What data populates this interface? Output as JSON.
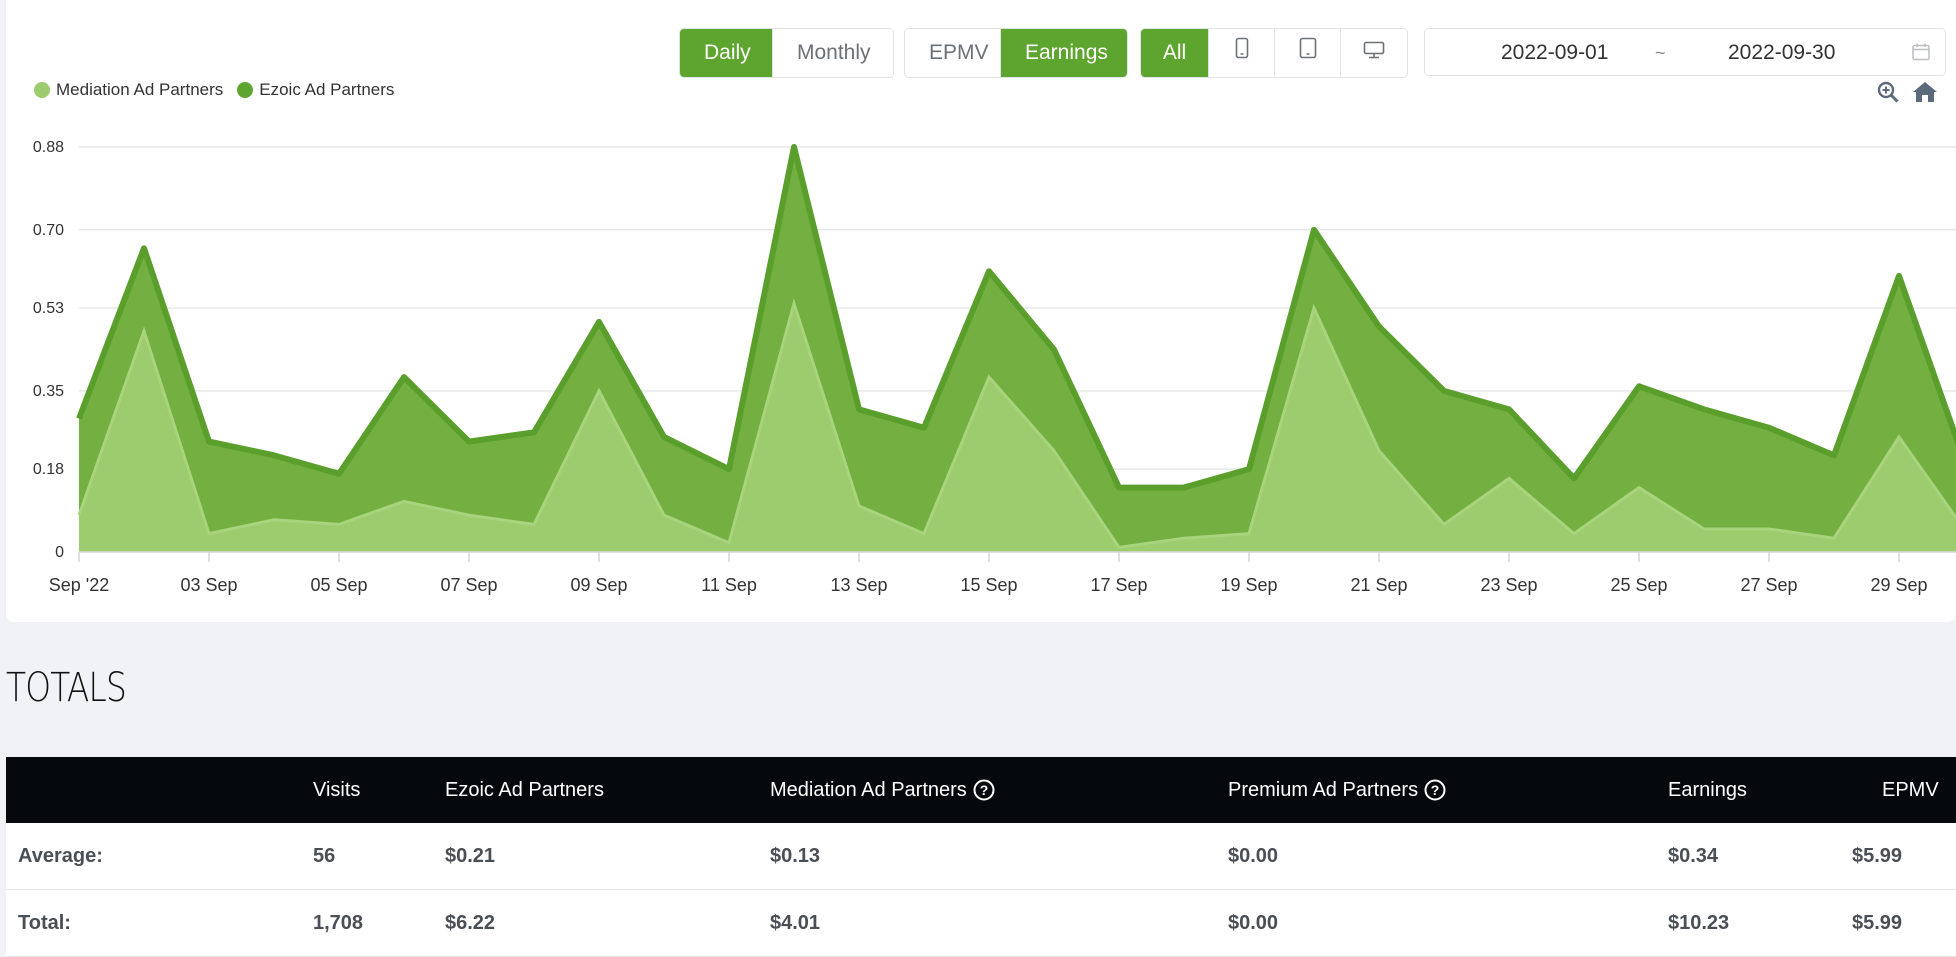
{
  "controls": {
    "period": [
      {
        "label": "Daily",
        "active": true
      },
      {
        "label": "Monthly",
        "active": false
      }
    ],
    "metric": [
      {
        "label": "EPMV",
        "active": false
      },
      {
        "label": "Earnings",
        "active": true
      }
    ],
    "device": [
      {
        "label": "All",
        "icon": "",
        "active": true
      },
      {
        "label": "",
        "icon": "mobile-icon",
        "active": false
      },
      {
        "label": "",
        "icon": "tablet-icon",
        "active": false
      },
      {
        "label": "",
        "icon": "desktop-icon",
        "active": false
      }
    ],
    "date_from": "2022-09-01",
    "date_sep": "~",
    "date_to": "2022-09-30"
  },
  "legend": [
    {
      "label": "Mediation Ad Partners",
      "color": "#9ccc6e"
    },
    {
      "label": "Ezoic Ad Partners",
      "color": "#5ea52f"
    }
  ],
  "chart_data": {
    "type": "area",
    "stacked": true,
    "x": [
      "2022-09-01",
      "2022-09-02",
      "2022-09-03",
      "2022-09-04",
      "2022-09-05",
      "2022-09-06",
      "2022-09-07",
      "2022-09-08",
      "2022-09-09",
      "2022-09-10",
      "2022-09-11",
      "2022-09-12",
      "2022-09-13",
      "2022-09-14",
      "2022-09-15",
      "2022-09-16",
      "2022-09-17",
      "2022-09-18",
      "2022-09-19",
      "2022-09-20",
      "2022-09-21",
      "2022-09-22",
      "2022-09-23",
      "2022-09-24",
      "2022-09-25",
      "2022-09-26",
      "2022-09-27",
      "2022-09-28",
      "2022-09-29",
      "2022-09-30"
    ],
    "x_tick_labels": [
      "Sep '22",
      "03 Sep",
      "05 Sep",
      "07 Sep",
      "09 Sep",
      "11 Sep",
      "13 Sep",
      "15 Sep",
      "17 Sep",
      "19 Sep",
      "21 Sep",
      "23 Sep",
      "25 Sep",
      "27 Sep",
      "29 Sep"
    ],
    "y_ticks": [
      "0",
      "0.18",
      "0.35",
      "0.53",
      "0.70",
      "0.88"
    ],
    "ylim": [
      0,
      0.88
    ],
    "grid": true,
    "legend_position": "top-left",
    "series": [
      {
        "name": "Mediation Ad Partners",
        "color": "#9ccc6e",
        "values": [
          0.08,
          0.48,
          0.04,
          0.07,
          0.06,
          0.11,
          0.08,
          0.06,
          0.35,
          0.08,
          0.02,
          0.54,
          0.1,
          0.04,
          0.38,
          0.22,
          0.01,
          0.03,
          0.04,
          0.53,
          0.22,
          0.06,
          0.16,
          0.04,
          0.14,
          0.05,
          0.05,
          0.03,
          0.25,
          0.05
        ]
      },
      {
        "name": "Ezoic Ad Partners",
        "color": "#5ea52f",
        "values": [
          0.21,
          0.18,
          0.2,
          0.14,
          0.11,
          0.27,
          0.16,
          0.2,
          0.15,
          0.17,
          0.16,
          0.34,
          0.21,
          0.23,
          0.23,
          0.22,
          0.13,
          0.11,
          0.14,
          0.17,
          0.27,
          0.29,
          0.15,
          0.12,
          0.22,
          0.26,
          0.22,
          0.18,
          0.35,
          0.15
        ]
      }
    ]
  },
  "totals": {
    "title": "TOTALS",
    "columns": [
      "",
      "Visits",
      "Ezoic Ad Partners",
      "Mediation Ad Partners",
      "Premium Ad Partners",
      "Earnings",
      "EPMV"
    ],
    "rows": [
      [
        "Average:",
        "56",
        "$0.21",
        "$0.13",
        "$0.00",
        "$0.34",
        "$5.99"
      ],
      [
        "Total:",
        "1,708",
        "$6.22",
        "$4.01",
        "$0.00",
        "$10.23",
        "$5.99"
      ]
    ]
  }
}
